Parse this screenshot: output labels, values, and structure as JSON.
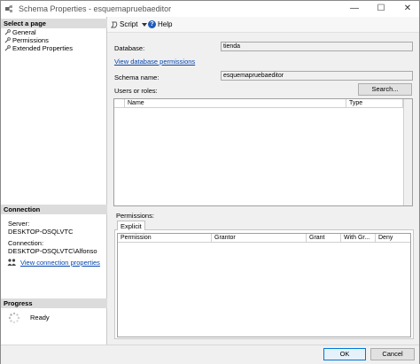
{
  "window": {
    "title": "Schema Properties - esquemapruebaeditor",
    "minimize": "—",
    "maximize": "☐",
    "close": "✕"
  },
  "left": {
    "select_page_header": "Select a page",
    "pages": [
      "General",
      "Permissions",
      "Extended Properties"
    ],
    "connection_header": "Connection",
    "server_label": "Server:",
    "server_value": "DESKTOP-OSQLVTC",
    "connection_label": "Connection:",
    "connection_value": "DESKTOP-OSQLVTC\\Alfonso",
    "view_connection_link": "View connection properties",
    "progress_header": "Progress",
    "progress_status": "Ready"
  },
  "toolbar": {
    "script_label": "Script",
    "help_label": "Help"
  },
  "main": {
    "database_label": "Database:",
    "database_value": "tienda",
    "view_db_permissions_link": "View database permissions",
    "schema_name_label": "Schema name:",
    "schema_name_value": "esquemapruebaeditor",
    "users_roles_label": "Users or roles:",
    "search_button": "Search...",
    "users_columns": [
      "Name",
      "Type"
    ],
    "permissions_label": "Permissions:",
    "tab_explicit": "Explicit",
    "perm_columns": [
      "Permission",
      "Grantor",
      "Grant",
      "With Gr...",
      "Deny"
    ]
  },
  "footer": {
    "ok": "OK",
    "cancel": "Cancel"
  },
  "colors": {
    "link": "#0645ad",
    "ok_border": "#0078d7",
    "section_header_bg": "#dcdcdc"
  }
}
